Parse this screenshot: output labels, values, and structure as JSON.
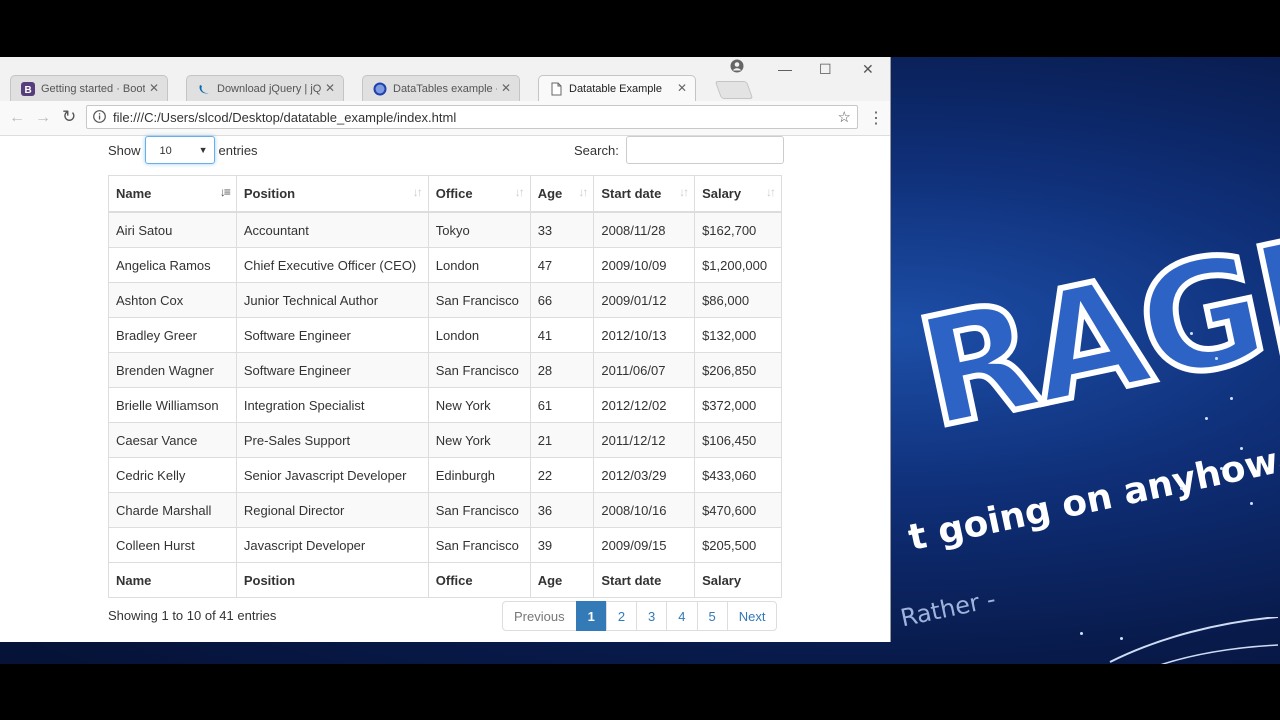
{
  "browser": {
    "tabs": [
      {
        "label": "Getting started · Bootstr",
        "icon": "bootstrap-icon"
      },
      {
        "label": "Download jQuery | jQuer",
        "icon": "jquery-icon"
      },
      {
        "label": "DataTables example - Bo",
        "icon": "datatables-icon"
      },
      {
        "label": "Datatable Example",
        "icon": "page-icon"
      }
    ],
    "url": "file:///C:/Users/slcod/Desktop/datatable_example/index.html"
  },
  "length": {
    "show_label": "Show",
    "value": "10",
    "entries_label": "entries"
  },
  "search": {
    "label": "Search:",
    "value": ""
  },
  "table": {
    "headers": [
      "Name",
      "Position",
      "Office",
      "Age",
      "Start date",
      "Salary"
    ],
    "rows": [
      [
        "Airi Satou",
        "Accountant",
        "Tokyo",
        "33",
        "2008/11/28",
        "$162,700"
      ],
      [
        "Angelica Ramos",
        "Chief Executive Officer (CEO)",
        "London",
        "47",
        "2009/10/09",
        "$1,200,000"
      ],
      [
        "Ashton Cox",
        "Junior Technical Author",
        "San Francisco",
        "66",
        "2009/01/12",
        "$86,000"
      ],
      [
        "Bradley Greer",
        "Software Engineer",
        "London",
        "41",
        "2012/10/13",
        "$132,000"
      ],
      [
        "Brenden Wagner",
        "Software Engineer",
        "San Francisco",
        "28",
        "2011/06/07",
        "$206,850"
      ],
      [
        "Brielle Williamson",
        "Integration Specialist",
        "New York",
        "61",
        "2012/12/02",
        "$372,000"
      ],
      [
        "Caesar Vance",
        "Pre-Sales Support",
        "New York",
        "21",
        "2011/12/12",
        "$106,450"
      ],
      [
        "Cedric Kelly",
        "Senior Javascript Developer",
        "Edinburgh",
        "22",
        "2012/03/29",
        "$433,060"
      ],
      [
        "Charde Marshall",
        "Regional Director",
        "San Francisco",
        "36",
        "2008/10/16",
        "$470,600"
      ],
      [
        "Colleen Hurst",
        "Javascript Developer",
        "San Francisco",
        "39",
        "2009/09/15",
        "$205,500"
      ]
    ],
    "footers": [
      "Name",
      "Position",
      "Office",
      "Age",
      "Start date",
      "Salary"
    ],
    "sorted_column": "Name"
  },
  "info": "Showing 1 to 10 of 41 entries",
  "pagination": {
    "previous": "Previous",
    "pages": [
      "1",
      "2",
      "3",
      "4",
      "5"
    ],
    "current": "1",
    "next": "Next"
  },
  "wallpaper": {
    "big_text": "RAGE",
    "tagline": "t going on anyhow.",
    "author": "Rather -"
  },
  "colors": {
    "accent": "#337ab7",
    "wallpaper_blue": "#0f2f78"
  }
}
